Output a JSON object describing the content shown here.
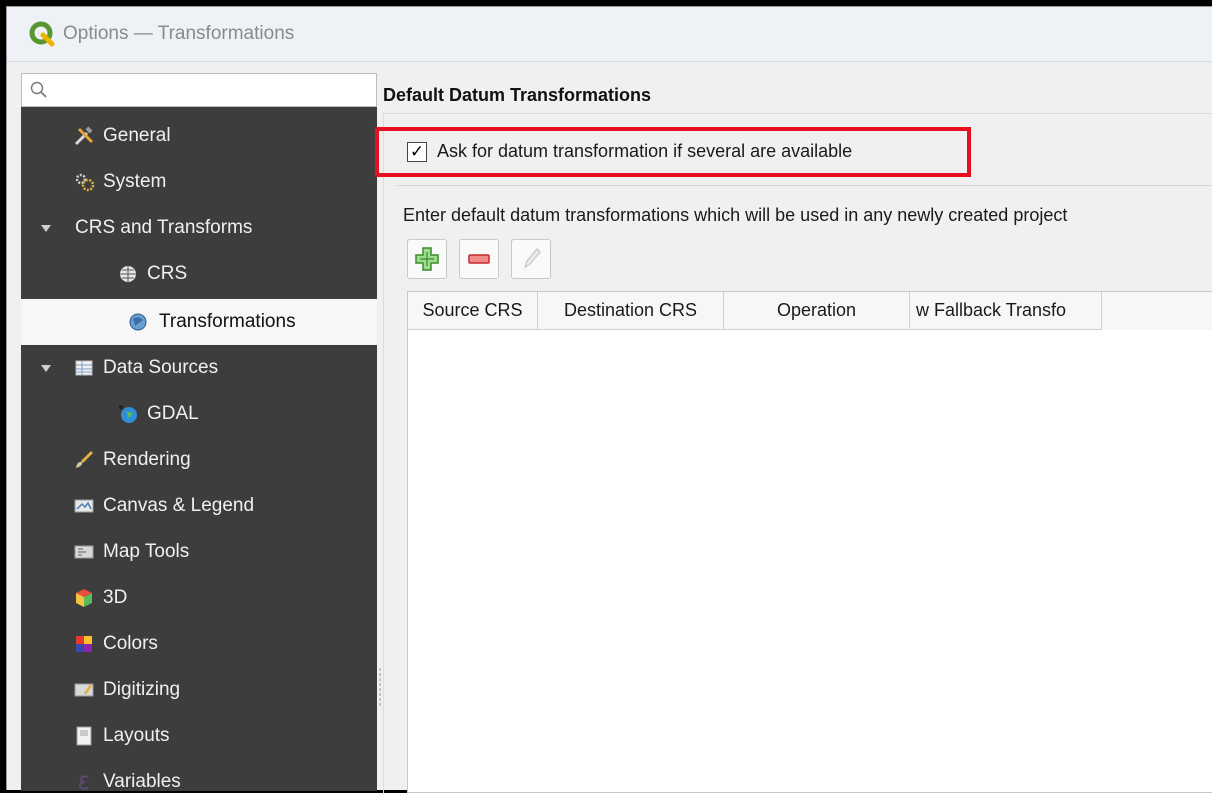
{
  "window": {
    "title": "Options — Transformations"
  },
  "search": {
    "placeholder": ""
  },
  "sidebar": {
    "items": [
      {
        "label": "General",
        "icon": "tools-icon"
      },
      {
        "label": "System",
        "icon": "system-gear-icon"
      },
      {
        "label": "CRS and Transforms",
        "expanded": true
      },
      {
        "label": "CRS",
        "icon": "globe-icon"
      },
      {
        "label": "Transformations",
        "icon": "globe-transform-icon",
        "selected": true
      },
      {
        "label": "Data Sources",
        "icon": "table-icon",
        "expanded": true
      },
      {
        "label": "GDAL",
        "icon": "gdal-globe-icon"
      },
      {
        "label": "Rendering",
        "icon": "brush-icon"
      },
      {
        "label": "Canvas & Legend",
        "icon": "canvas-icon"
      },
      {
        "label": "Map Tools",
        "icon": "map-tools-icon"
      },
      {
        "label": "3D",
        "icon": "cube-icon"
      },
      {
        "label": "Colors",
        "icon": "color-palette-icon"
      },
      {
        "label": "Digitizing",
        "icon": "digitizing-icon"
      },
      {
        "label": "Layouts",
        "icon": "layout-icon"
      },
      {
        "label": "Variables",
        "icon": "variable-epsilon-icon"
      }
    ]
  },
  "main": {
    "section_title": "Default Datum Transformations",
    "ask_checkbox": {
      "label": "Ask for datum transformation if several are available",
      "checked": true,
      "check_glyph": "✓"
    },
    "hint": "Enter default datum transformations which will be used in any newly created project",
    "toolbar": {
      "add": "add-icon",
      "remove": "remove-icon",
      "edit": "edit-pencil-icon"
    },
    "table": {
      "columns": [
        "Source CRS",
        "Destination CRS",
        "Operation",
        "w Fallback Transfo"
      ]
    }
  },
  "colors": {
    "sidebar_bg": "#3d3d3d",
    "highlight": "#e8101e",
    "qgis_green": "#589632"
  }
}
